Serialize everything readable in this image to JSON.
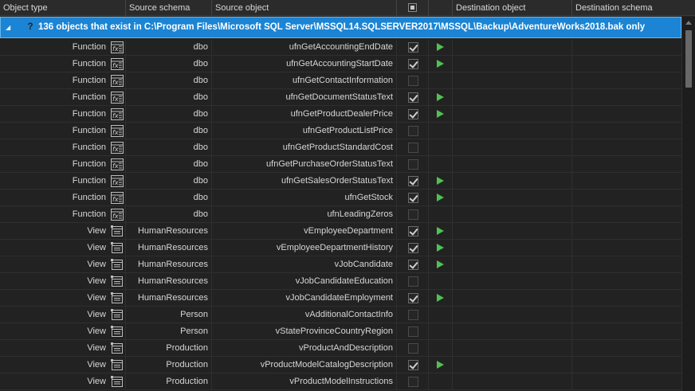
{
  "columns": {
    "object_type": "Object type",
    "source_schema": "Source schema",
    "source_object": "Source object",
    "destination_object": "Destination object",
    "destination_schema": "Destination schema"
  },
  "group": {
    "text": "136 objects that exist in C:\\Program Files\\Microsoft SQL Server\\MSSQL14.SQLSERVER2017\\MSSQL\\Backup\\AdventureWorks2018.bak only",
    "expanded": true,
    "icon": "question-mark-icon"
  },
  "colors": {
    "group_bg": "#1b84d4",
    "play": "#4fc24f",
    "grid_bg": "#222222"
  },
  "rows": [
    {
      "type": "Function",
      "icon": "function-icon",
      "schema": "dbo",
      "object": "ufnGetAccountingEndDate",
      "checked": true,
      "action": true
    },
    {
      "type": "Function",
      "icon": "function-icon",
      "schema": "dbo",
      "object": "ufnGetAccountingStartDate",
      "checked": true,
      "action": true
    },
    {
      "type": "Function",
      "icon": "function-icon",
      "schema": "dbo",
      "object": "ufnGetContactInformation",
      "checked": false,
      "action": false
    },
    {
      "type": "Function",
      "icon": "function-icon",
      "schema": "dbo",
      "object": "ufnGetDocumentStatusText",
      "checked": true,
      "action": true
    },
    {
      "type": "Function",
      "icon": "function-icon",
      "schema": "dbo",
      "object": "ufnGetProductDealerPrice",
      "checked": true,
      "action": true
    },
    {
      "type": "Function",
      "icon": "function-icon",
      "schema": "dbo",
      "object": "ufnGetProductListPrice",
      "checked": false,
      "action": false
    },
    {
      "type": "Function",
      "icon": "function-icon",
      "schema": "dbo",
      "object": "ufnGetProductStandardCost",
      "checked": false,
      "action": false
    },
    {
      "type": "Function",
      "icon": "function-icon",
      "schema": "dbo",
      "object": "ufnGetPurchaseOrderStatusText",
      "checked": false,
      "action": false
    },
    {
      "type": "Function",
      "icon": "function-icon",
      "schema": "dbo",
      "object": "ufnGetSalesOrderStatusText",
      "checked": true,
      "action": true
    },
    {
      "type": "Function",
      "icon": "function-icon",
      "schema": "dbo",
      "object": "ufnGetStock",
      "checked": true,
      "action": true
    },
    {
      "type": "Function",
      "icon": "function-icon",
      "schema": "dbo",
      "object": "ufnLeadingZeros",
      "checked": false,
      "action": false
    },
    {
      "type": "View",
      "icon": "view-icon",
      "schema": "HumanResources",
      "object": "vEmployeeDepartment",
      "checked": true,
      "action": true
    },
    {
      "type": "View",
      "icon": "view-icon",
      "schema": "HumanResources",
      "object": "vEmployeeDepartmentHistory",
      "checked": true,
      "action": true
    },
    {
      "type": "View",
      "icon": "view-icon",
      "schema": "HumanResources",
      "object": "vJobCandidate",
      "checked": true,
      "action": true
    },
    {
      "type": "View",
      "icon": "view-icon",
      "schema": "HumanResources",
      "object": "vJobCandidateEducation",
      "checked": false,
      "action": false
    },
    {
      "type": "View",
      "icon": "view-icon",
      "schema": "HumanResources",
      "object": "vJobCandidateEmployment",
      "checked": true,
      "action": true
    },
    {
      "type": "View",
      "icon": "view-icon",
      "schema": "Person",
      "object": "vAdditionalContactInfo",
      "checked": false,
      "action": false
    },
    {
      "type": "View",
      "icon": "view-icon",
      "schema": "Person",
      "object": "vStateProvinceCountryRegion",
      "checked": false,
      "action": false
    },
    {
      "type": "View",
      "icon": "view-icon",
      "schema": "Production",
      "object": "vProductAndDescription",
      "checked": false,
      "action": false
    },
    {
      "type": "View",
      "icon": "view-icon",
      "schema": "Production",
      "object": "vProductModelCatalogDescription",
      "checked": true,
      "action": true
    },
    {
      "type": "View",
      "icon": "view-icon",
      "schema": "Production",
      "object": "vProductModelInstructions",
      "checked": false,
      "action": false
    }
  ]
}
